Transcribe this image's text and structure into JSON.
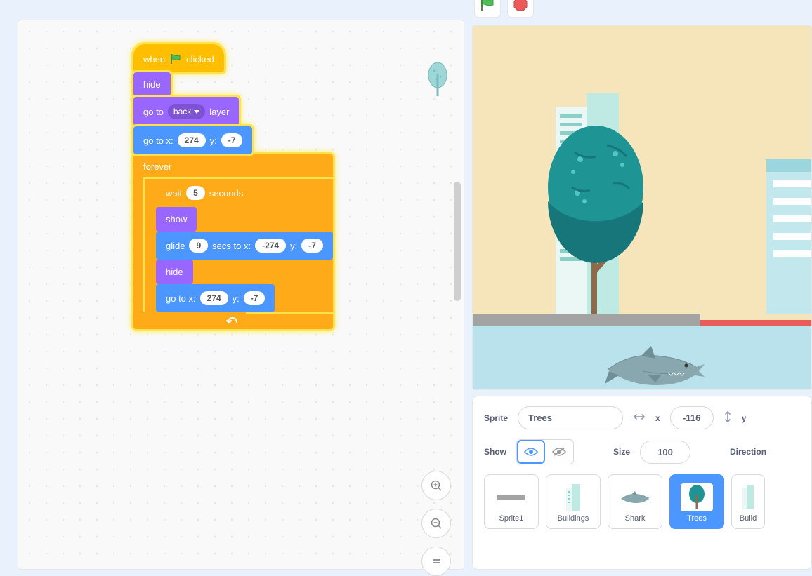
{
  "colors": {
    "events": "#ffbf00",
    "control": "#ffab19",
    "looks": "#9966ff",
    "motion": "#4c97ff",
    "highlight": "#ffe24d"
  },
  "blocks": {
    "when_clicked_prefix": "when",
    "when_clicked_suffix": "clicked",
    "hide": "hide",
    "goto_layer_prefix": "go to",
    "goto_layer_dropdown": "back",
    "goto_layer_suffix": "layer",
    "gotoxy_prefix": "go to x:",
    "gotoxy_x": "274",
    "gotoxy_mid": "y:",
    "gotoxy_y": "-7",
    "forever": "forever",
    "wait_prefix": "wait",
    "wait_val": "5",
    "wait_suffix": "seconds",
    "show": "show",
    "glide_prefix": "glide",
    "glide_secs": "9",
    "glide_mid1": "secs to x:",
    "glide_x": "-274",
    "glide_mid2": "y:",
    "glide_y": "-7",
    "hide2": "hide",
    "gotoxy2_prefix": "go to x:",
    "gotoxy2_x": "274",
    "gotoxy2_mid": "y:",
    "gotoxy2_y": "-7"
  },
  "spriteinfo": {
    "sprite_label": "Sprite",
    "name": "Trees",
    "x_label": "x",
    "x_val": "-116",
    "y_label": "y",
    "show_label": "Show",
    "size_label": "Size",
    "size_val": "100",
    "direction_label": "Direction"
  },
  "sprites": [
    {
      "label": "Sprite1"
    },
    {
      "label": "Buildings"
    },
    {
      "label": "Shark"
    },
    {
      "label": "Trees",
      "selected": true
    },
    {
      "label": "Build"
    }
  ]
}
